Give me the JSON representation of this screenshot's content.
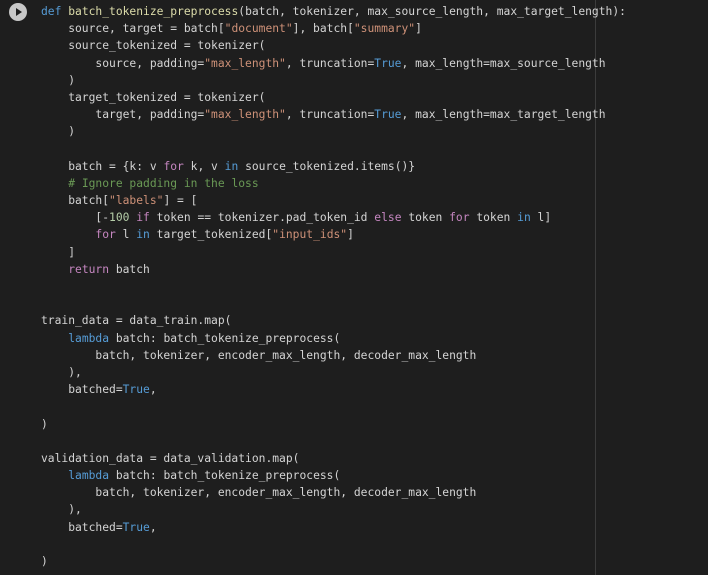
{
  "cell": {
    "run_icon": "play-icon",
    "lines": [
      [
        {
          "t": "def",
          "c": "kw"
        },
        {
          "t": " "
        },
        {
          "t": "batch_tokenize_preprocess",
          "c": "fn"
        },
        {
          "t": "(batch, tokenizer, max_source_length, max_target_length):"
        }
      ],
      [
        {
          "t": "    source, target = batch["
        },
        {
          "t": "\"document\"",
          "c": "str"
        },
        {
          "t": "], batch["
        },
        {
          "t": "\"summary\"",
          "c": "str"
        },
        {
          "t": "]"
        }
      ],
      [
        {
          "t": "    source_tokenized = tokenizer("
        }
      ],
      [
        {
          "t": "        source, padding="
        },
        {
          "t": "\"max_length\"",
          "c": "str"
        },
        {
          "t": ", truncation="
        },
        {
          "t": "True",
          "c": "kw"
        },
        {
          "t": ", max_length=max_source_length"
        }
      ],
      [
        {
          "t": "    )"
        }
      ],
      [
        {
          "t": "    target_tokenized = tokenizer("
        }
      ],
      [
        {
          "t": "        target, padding="
        },
        {
          "t": "\"max_length\"",
          "c": "str"
        },
        {
          "t": ", truncation="
        },
        {
          "t": "True",
          "c": "kw"
        },
        {
          "t": ", max_length=max_target_length"
        }
      ],
      [
        {
          "t": "    )"
        }
      ],
      [],
      [
        {
          "t": "    batch = {k: v "
        },
        {
          "t": "for",
          "c": "ctl"
        },
        {
          "t": " k, v "
        },
        {
          "t": "in",
          "c": "kw"
        },
        {
          "t": " source_tokenized.items()}"
        }
      ],
      [
        {
          "t": "    "
        },
        {
          "t": "# Ignore padding in the loss",
          "c": "com"
        }
      ],
      [
        {
          "t": "    batch["
        },
        {
          "t": "\"labels\"",
          "c": "str"
        },
        {
          "t": "] = ["
        }
      ],
      [
        {
          "t": "        [-"
        },
        {
          "t": "100",
          "c": "num"
        },
        {
          "t": " "
        },
        {
          "t": "if",
          "c": "ctl"
        },
        {
          "t": " token == tokenizer.pad_token_id "
        },
        {
          "t": "else",
          "c": "ctl"
        },
        {
          "t": " token "
        },
        {
          "t": "for",
          "c": "ctl"
        },
        {
          "t": " token "
        },
        {
          "t": "in",
          "c": "kw"
        },
        {
          "t": " l]"
        }
      ],
      [
        {
          "t": "        "
        },
        {
          "t": "for",
          "c": "ctl"
        },
        {
          "t": " l "
        },
        {
          "t": "in",
          "c": "kw"
        },
        {
          "t": " target_tokenized["
        },
        {
          "t": "\"input_ids\"",
          "c": "str"
        },
        {
          "t": "]"
        }
      ],
      [
        {
          "t": "    ]"
        }
      ],
      [
        {
          "t": "    "
        },
        {
          "t": "return",
          "c": "ctl"
        },
        {
          "t": " batch"
        }
      ],
      [],
      [],
      [
        {
          "t": "train_data = data_train.map("
        }
      ],
      [
        {
          "t": "    "
        },
        {
          "t": "lambda",
          "c": "kw"
        },
        {
          "t": " batch: batch_tokenize_preprocess("
        }
      ],
      [
        {
          "t": "        batch, tokenizer, encoder_max_length, decoder_max_length"
        }
      ],
      [
        {
          "t": "    ),"
        }
      ],
      [
        {
          "t": "    batched="
        },
        {
          "t": "True",
          "c": "kw"
        },
        {
          "t": ","
        }
      ],
      [],
      [
        {
          "t": ")"
        }
      ],
      [],
      [
        {
          "t": "validation_data = data_validation.map("
        }
      ],
      [
        {
          "t": "    "
        },
        {
          "t": "lambda",
          "c": "kw"
        },
        {
          "t": " batch: batch_tokenize_preprocess("
        }
      ],
      [
        {
          "t": "        batch, tokenizer, encoder_max_length, decoder_max_length"
        }
      ],
      [
        {
          "t": "    ),"
        }
      ],
      [
        {
          "t": "    batched="
        },
        {
          "t": "True",
          "c": "kw"
        },
        {
          "t": ","
        }
      ],
      [],
      [
        {
          "t": ")"
        }
      ]
    ]
  }
}
